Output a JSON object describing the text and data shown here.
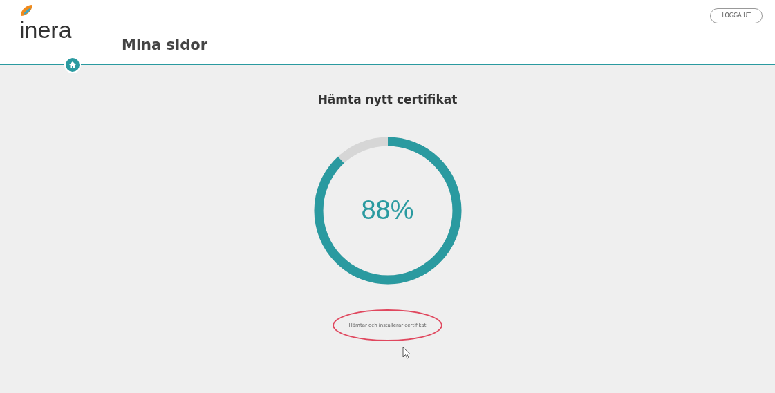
{
  "header": {
    "logo": "inera",
    "title": "Mina sidor",
    "logout_button": "LOGGA UT"
  },
  "main": {
    "heading": "Hämta nytt certifikat",
    "progress": {
      "level": 0.88,
      "reading": "88%"
    },
    "status": "Hämtar och installerar certifikat",
    "status_highlighted": true
  }
}
